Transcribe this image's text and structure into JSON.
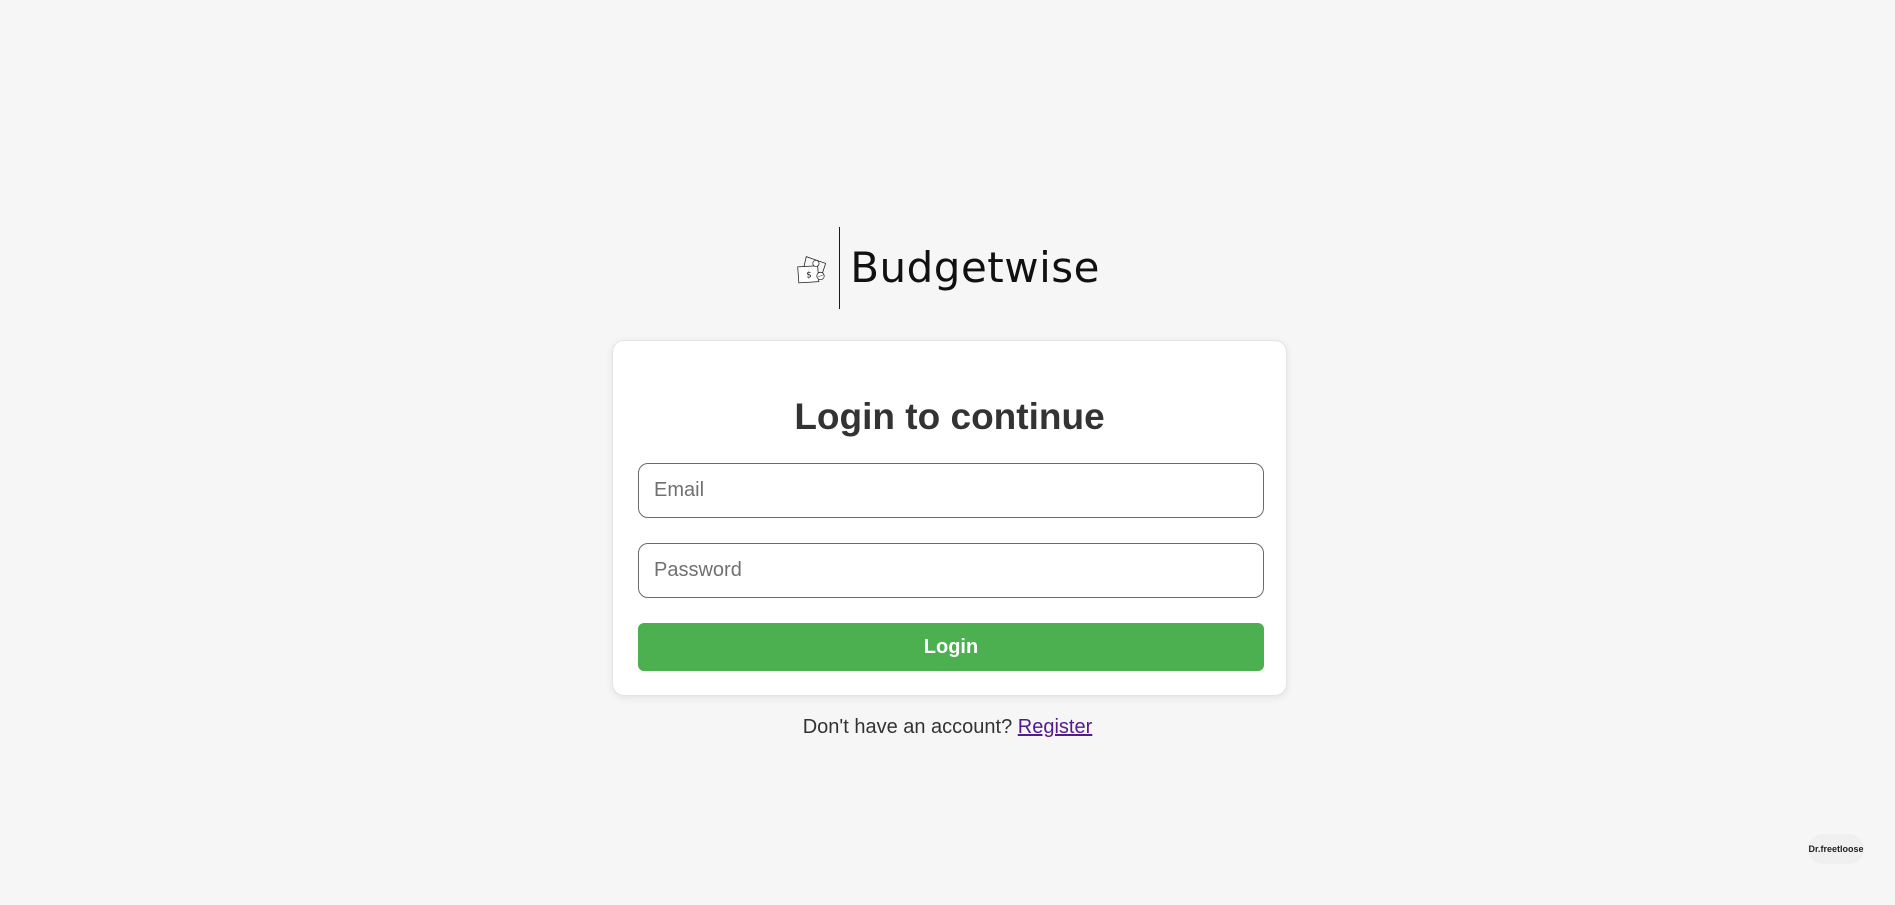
{
  "brand": {
    "logo_icon": "money-bills-coins-icon",
    "name": "Budgetwise"
  },
  "login_form": {
    "heading": "Login to continue",
    "email_placeholder": "Email",
    "email_value": "",
    "password_placeholder": "Password",
    "password_value": "",
    "submit_label": "Login"
  },
  "register_prompt": {
    "text": "Don't have an account?",
    "link_label": "Register"
  },
  "corner_badge": {
    "label": "Dr.freetloose"
  },
  "colors": {
    "background": "#f6f6f6",
    "card": "#ffffff",
    "primary_button": "#4caf50",
    "link_visited": "#551a8b",
    "heading_text": "#333333"
  }
}
